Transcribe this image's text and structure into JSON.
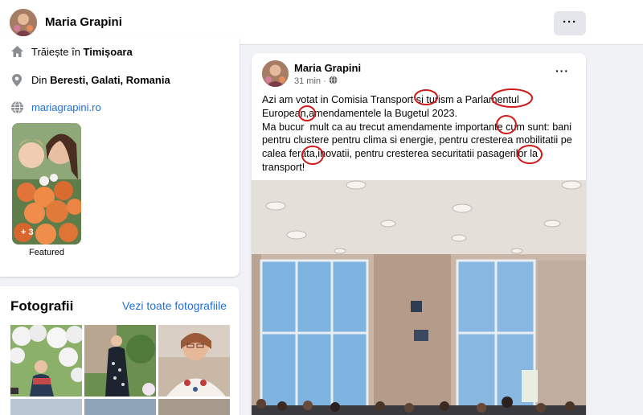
{
  "header": {
    "name": "Maria Grapini",
    "more_label": "···"
  },
  "intro": {
    "lives_prefix": "Trăiește în ",
    "lives_city": "Timișoara",
    "from_prefix": "Din ",
    "from_place": "Beresti, Galati, Romania",
    "website": "mariagrapini.ro",
    "featured_count": "+ 3",
    "featured_label": "Featured"
  },
  "photos": {
    "title": "Fotografii",
    "see_all": "Vezi toate fotografiile"
  },
  "post": {
    "author": "Maria Grapini",
    "time": "31 min ·",
    "more_label": "···",
    "lines": [
      "Azi am votat in Comisia Transport si turism a Parlamentul",
      "European,amendamentele la Bugetul 2023.",
      "Ma bucur  mult ca au trecut amendamente importante cum sunt: bani",
      "pentru clustere pentru clima si energie, pentru cresterea mobilitatii pe",
      "calea ferata,inovatii, pentru cresterea securitatii pasagerilor la",
      "transport!"
    ]
  },
  "colors": {
    "link": "#216fdb",
    "annotation": "#d11a1a",
    "background": "#f0f2f5"
  }
}
